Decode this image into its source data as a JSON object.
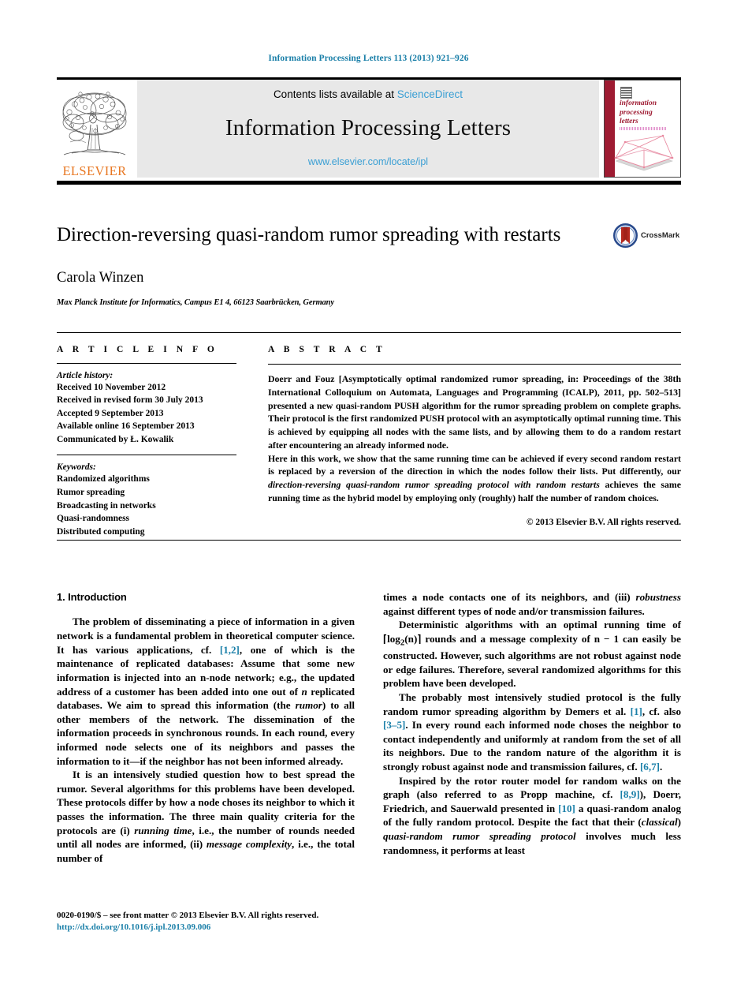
{
  "running_head": "Information Processing Letters 113 (2013) 921–926",
  "masthead": {
    "contents_prefix": "Contents lists available at ",
    "sciencedirect": "ScienceDirect",
    "journal_title": "Information Processing Letters",
    "journal_url": "www.elsevier.com/locate/ipl",
    "publisher_wordmark": "ELSEVIER",
    "cover_title_lines": [
      "information",
      "processing",
      "letters"
    ]
  },
  "article": {
    "title": "Direction-reversing quasi-random rumor spreading with restarts",
    "author": "Carola Winzen",
    "affiliation": "Max Planck Institute for Informatics, Campus E1 4, 66123 Saarbrücken, Germany",
    "crossmark_label": "CrossMark"
  },
  "info": {
    "heading": "A R T I C L E    I N F O",
    "history_label": "Article history:",
    "history": [
      "Received 10 November 2012",
      "Received in revised form 30 July 2013",
      "Accepted 9 September 2013",
      "Available online 16 September 2013",
      "Communicated by Ł. Kowalik"
    ],
    "keywords_label": "Keywords:",
    "keywords": [
      "Randomized algorithms",
      "Rumor spreading",
      "Broadcasting in networks",
      "Quasi-randomness",
      "Distributed computing"
    ]
  },
  "abstract": {
    "heading": "A B S T R A C T",
    "paragraph1_a": "Doerr and Fouz [Asymptotically optimal randomized rumor spreading, in: Proceedings of the 38th International Colloquium on Automata, Languages and Programming (ICALP), 2011, pp. 502–513] presented a new quasi-random PUSH algorithm for the rumor spreading problem on complete graphs. Their protocol is the first randomized PUSH protocol with an asymptotically optimal running time. This is achieved by equipping all nodes with the same lists, and by allowing them to do a random restart after encountering an already informed node.",
    "paragraph2_a": "Here in this work, we show that the same running time can be achieved if every second random restart is replaced by a reversion of the direction in which the nodes follow their lists. Put differently, our ",
    "paragraph2_italic1": "direction-reversing quasi-random rumor spreading protocol with random restarts",
    "paragraph2_b": " achieves the same running time as the hybrid model by employing only (roughly) half the number of random choices.",
    "copyright": "© 2013 Elsevier B.V. All rights reserved."
  },
  "body": {
    "section_heading": "1. Introduction",
    "left": {
      "p1_a": "The problem of disseminating a piece of information in a given network is a fundamental problem in theoretical computer science. It has various applications, cf. ",
      "p1_ref1": "[1,2]",
      "p1_b": ", one of which is the maintenance of replicated databases: Assume that some new information is injected into an n-node network; e.g., the updated address of a customer has been added into one out of ",
      "p1_math1": "n",
      "p1_c": " replicated databases. We aim to spread this information (the ",
      "p1_italic1": "rumor",
      "p1_d": ") to all other members of the network. The dissemination of the information proceeds in synchronous rounds. In each round, every informed node selects one of its neighbors and passes the information to it—if the neighbor has not been informed already.",
      "p2_a": "It is an intensively studied question how to best spread the rumor. Several algorithms for this problems have been developed. These protocols differ by how a node choses its neighbor to which it passes the information. The three main quality criteria for the protocols are (i) ",
      "p2_italic1": "running time",
      "p2_b": ", i.e., the number of rounds needed until all nodes are informed, (ii) ",
      "p2_italic2": "message complexity",
      "p2_c": ", i.e., the total number of"
    },
    "right": {
      "p1_a": "times a node contacts one of its neighbors, and (iii) ",
      "p1_italic1": "robustness",
      "p1_b": " against different types of node and/or transmission failures.",
      "p2_a": "Deterministic algorithms with an optimal running time of ⌈log",
      "p2_sub": "2",
      "p2_b": "(n)⌉ rounds and a message complexity of n − 1 can easily be constructed. However, such algorithms are not robust against node or edge failures. Therefore, several randomized algorithms for this problem have been developed.",
      "p3_a": "The probably most intensively studied protocol is the fully random rumor spreading algorithm by Demers et al. ",
      "p3_ref1": "[1]",
      "p3_b": ", cf. also ",
      "p3_ref2": "[3–5]",
      "p3_c": ". In every round each informed node choses the neighbor to contact independently and uniformly at random from the set of all its neighbors. Due to the random nature of the algorithm it is strongly robust against node and transmission failures, cf. ",
      "p3_ref3": "[6,7]",
      "p3_d": ".",
      "p4_a": "Inspired by the rotor router model for random walks on the graph (also referred to as Propp machine, cf. ",
      "p4_ref1": "[8,9]",
      "p4_b": "), Doerr, Friedrich, and Sauerwald presented in ",
      "p4_ref2": "[10]",
      "p4_c": " a quasi-random analog of the fully random protocol. Despite the fact that their (",
      "p4_italic1": "classical",
      "p4_d": ") ",
      "p4_italic2": "quasi-random rumor spreading protocol",
      "p4_e": " involves much less randomness, it performs at least"
    }
  },
  "footer": {
    "line1": "0020-0190/$ – see front matter  © 2013 Elsevier B.V. All rights reserved.",
    "doi": "http://dx.doi.org/10.1016/j.ipl.2013.09.006"
  },
  "colors": {
    "link_blue": "#1a7fa8",
    "sciencedirect_blue": "#3a9fd4",
    "elsevier_orange": "#E87722",
    "cover_red": "#9e1b32"
  }
}
